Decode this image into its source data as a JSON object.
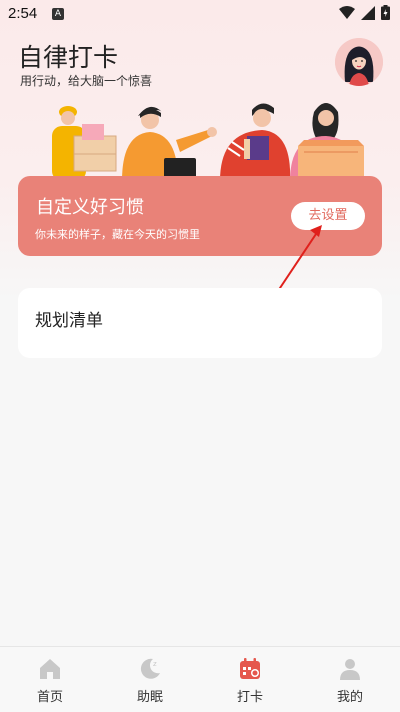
{
  "status": {
    "time": "2:54",
    "badge": "A"
  },
  "header": {
    "title": "自律打卡",
    "subtitle": "用行动，给大脑一个惊喜"
  },
  "banner": {
    "title": "自定义好习惯",
    "subtitle": "你未来的样子，藏在今天的习惯里",
    "button_label": "去设置"
  },
  "card": {
    "title": "规划清单"
  },
  "tabs": [
    {
      "label": "首页",
      "icon": "home-icon"
    },
    {
      "label": "助眠",
      "icon": "moon-icon"
    },
    {
      "label": "打卡",
      "icon": "calendar-check-icon",
      "active": true
    },
    {
      "label": "我的",
      "icon": "user-icon"
    }
  ],
  "colors": {
    "accent": "#e98278",
    "active_tab": "#e5574d",
    "inactive_tab": "#c8c8c8"
  }
}
